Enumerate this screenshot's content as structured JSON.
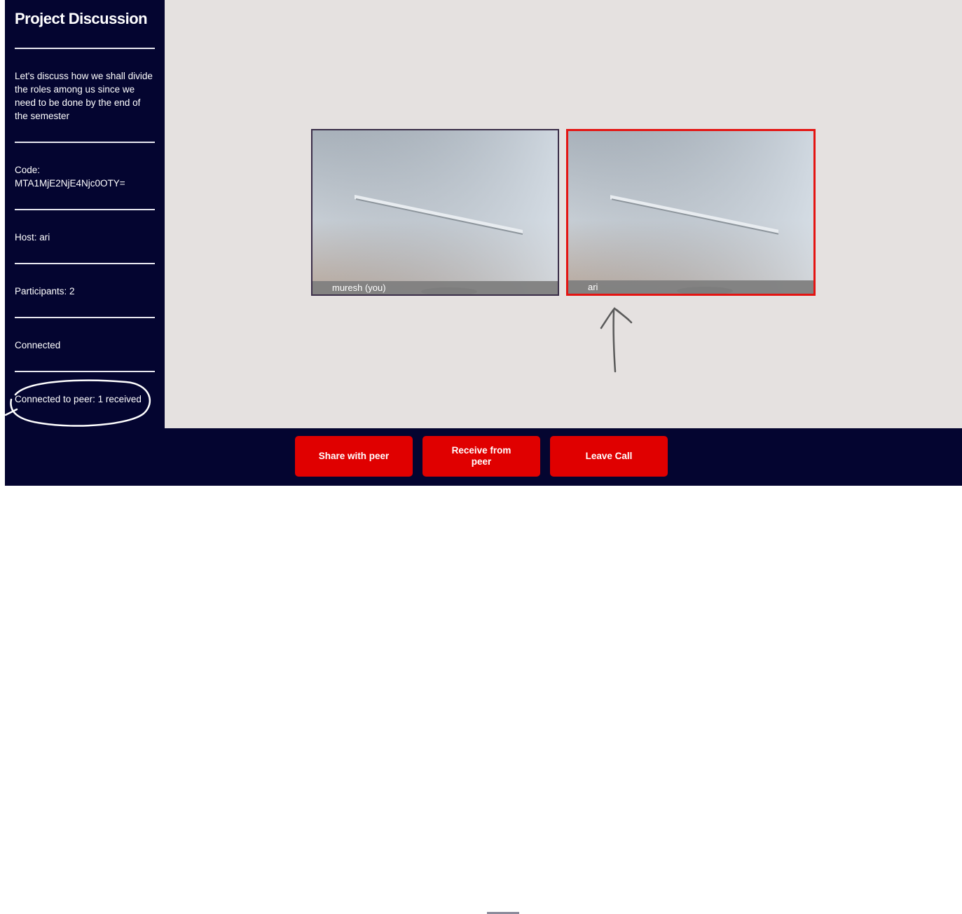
{
  "sidebar": {
    "title": "Project Discussion",
    "description": "Let's discuss how we shall divide the roles among us since we need to be done by the end of the semester",
    "code_label": "Code:",
    "code_value": "MTA1MjE2NjE4Njc0OTY=",
    "host": "Host: ari",
    "participants": "Participants: 2",
    "status": "Connected",
    "peer_status": "Connected to peer: 1 received"
  },
  "tiles": [
    {
      "name": "muresh (you)",
      "active_speaker": false
    },
    {
      "name": "ari",
      "active_speaker": true,
      "highlight_color": "#e41412"
    }
  ],
  "controls": {
    "share": "Share with peer",
    "receive": "Receive from peer",
    "leave": "Leave Call"
  },
  "colors": {
    "sidebar_bg": "#040530",
    "stage_bg": "#e5e1e0",
    "button_bg": "#e00000"
  }
}
